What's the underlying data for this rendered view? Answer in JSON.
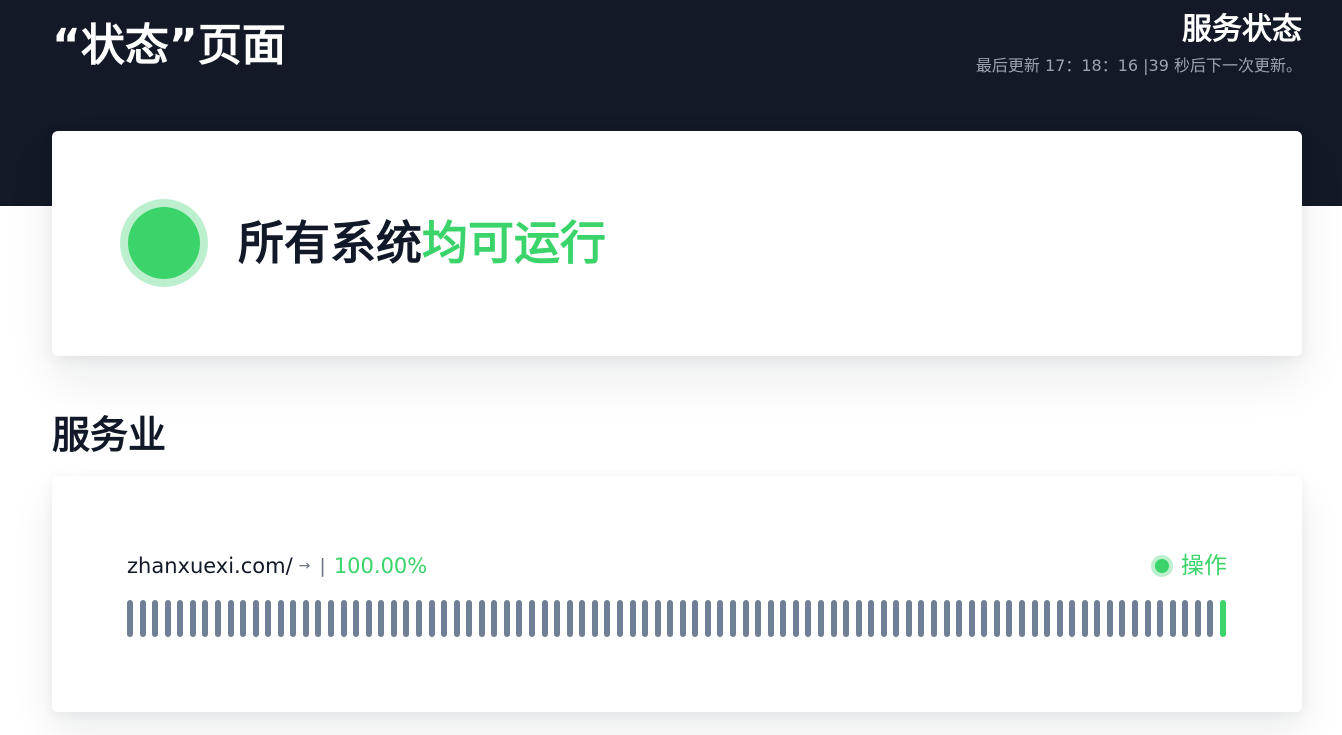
{
  "header": {
    "title": "“状态”页面",
    "service_status_title": "服务状态",
    "update_text": "最后更新 17：18：16 |39 秒后下一次更新。"
  },
  "overall_status": {
    "text_prefix": "所有系统",
    "text_accent": "均可运行",
    "dot_icon": "green-status-dot-icon"
  },
  "services_section": {
    "title": "服务业",
    "items": [
      {
        "name": "zhanxuexi.com/",
        "link_icon": "arrow-right-icon",
        "separator": "|",
        "uptime": "100.00%",
        "status_label": "操作",
        "status_icon": "operational-dot-icon",
        "history_count": 88,
        "current_history_count": 1
      }
    ]
  },
  "colors": {
    "header_background": "#131926",
    "operational_green": "#3bd46b",
    "operational_green_soft": "#bcefcd",
    "history_bar_gray": "#6f7f95",
    "muted_text": "#9ca3af"
  }
}
